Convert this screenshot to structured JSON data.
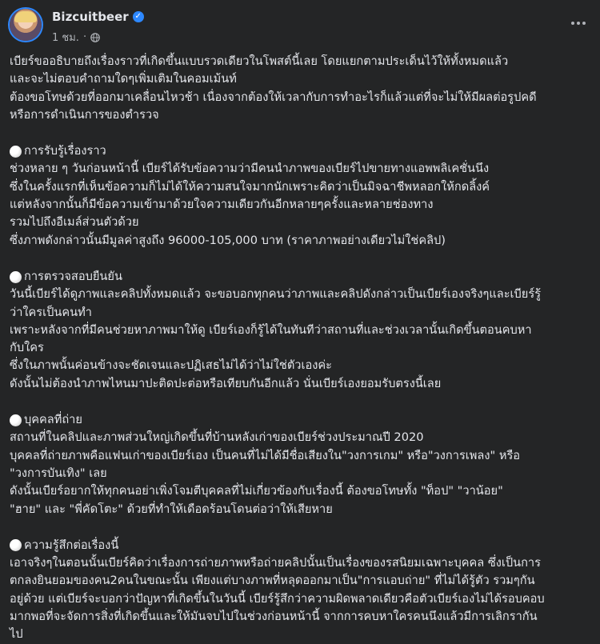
{
  "post": {
    "author": "Bizcuitbeer",
    "time": "1 ชม.",
    "meta_separator": "·"
  },
  "intro": [
    "เบียร์ขออธิบายถึงเรื่องราวที่เกิดขึ้นแบบรวดเดียวในโพสต์นี้เลย โดยแยกตามประเด็นไว้ให้ทั้งหมดแล้ว",
    "และจะไม่ตอบคำถามใดๆเพิ่มเติมในคอมเม้นท์",
    "ต้องขอโทษด้วยที่ออกมาเคลื่อนไหวช้า เนื่องจากต้องให้เวลากับการทำอะไรก็แล้วแต่ที่จะไม่ให้มีผลต่อรูปคดี",
    "หรือการดำเนินการของตำรวจ"
  ],
  "sections": [
    {
      "title": "การรับรู้เรื่องราว",
      "lines": [
        "ช่วงหลาย ๆ วันก่อนหน้านี้ เบียร์ได้รับข้อความว่ามีคนนำภาพของเบียร์ไปขายทางแอพพลิเคชั่นนึง",
        "ซึ่งในครั้งแรกที่เห็นข้อความก็ไม่ได้ให้ความสนใจมากนักเพราะคิดว่าเป็นมิจฉาชีพหลอกให้กดลิ้งค์",
        "แต่หลังจากนั้นก็มีข้อความเข้ามาด้วยใจความเดียวกันอีกหลายๆครั้งและหลายช่องทาง",
        "รวมไปถึงอีเมล์ส่วนตัวด้วย",
        "ซึ่งภาพดังกล่าวนั้นมีมูลค่าสูงถึง 96000-105,000 บาท (ราคาภาพอย่างเดียวไม่ใช่คลิป)"
      ]
    },
    {
      "title": "การตรวจสอบยืนยัน",
      "lines": [
        "วันนี้เบียร์ได้ดูภาพและคลิปทั้งหมดแล้ว จะขอบอกทุกคนว่าภาพและคลิปดังกล่าวเป็นเบียร์เองจริงๆและเบียร์รู้",
        "ว่าใครเป็นคนทำ",
        "เพราะหลังจากที่มีคนช่วยหาภาพมาให้ดู เบียร์เองก็รู้ได้ในทันทีว่าสถานที่และช่วงเวลานั้นเกิดขึ้นตอนคบหา",
        "กับใคร",
        "ซึ่งในภาพนั้นค่อนข้างจะชัดเจนและปฏิเสธไม่ได้ว่าไม่ใช่ตัวเองค่ะ",
        "ดังนั้นไม่ต้องนำภาพไหนมาปะติดปะต่อหรือเทียบกันอีกแล้ว นั่นเบียร์เองยอมรับตรงนี้เลย"
      ]
    },
    {
      "title": "บุคคลที่ถ่าย",
      "lines": [
        "สถานที่ในคลิปและภาพส่วนใหญ่เกิดขึ้นที่บ้านหลังเก่าของเบียร์ช่วงประมาณปี 2020",
        "บุคคลที่ถ่ายภาพคือแฟนเก่าของเบียร์เอง เป็นคนที่ไม่ได้มีชื่อเสียงใน\"วงการเกม\" หรือ\"วงการเพลง\" หรือ",
        "\"วงการบันเทิง\" เลย",
        "ดังนั้นเบียร์อยากให้ทุกคนอย่าเพิ่งโจมตีบุคคลที่ไม่เกี่ยวข้องกับเรื่องนี้  ต้องขอโทษทั้ง \"ท็อป\"  \"วาน้อย\"",
        "\"ฮาย\" และ \"พี่คัดโตะ\" ด้วยที่ทำให้เดือดร้อนโดนต่อว่าให้เสียหาย"
      ]
    },
    {
      "title": "ความรู้สึกต่อเรื่องนี้",
      "lines": [
        "เอาจริงๆในตอนนั้นเบียร์คิดว่าเรื่องการถ่ายภาพหรือถ่ายคลิปนั้นเป็นเรื่องของรสนิยมเฉพาะบุคคล ซึ่งเป็นการ",
        "ตกลงยินยอมของคน2คนในขณะนั้น เพียงแต่บางภาพที่หลุดออกมาเป็น\"การแอบถ่าย\" ที่ไม่ได้รู้ตัว รวมๆกัน",
        "อยู่ด้วย แต่เบียร์จะบอกว่าปัญหาที่เกิดขึ้นในวันนี้ เบียร์รู้สึกว่าความผิดพลาดเดียวคือตัวเบียร์เองไม่ได้รอบคอบ",
        "มากพอที่จะจัดการสิ่งที่เกิดขึ้นและให้มันจบไปในช่วงก่อนหน้านี้ จากการคบหาใครคนนึงแล้วมีการเลิกรากัน",
        "ไป"
      ]
    }
  ],
  "icons": {
    "verified": "verified-badge-icon",
    "globe": "globe-icon",
    "more": "more-options-icon",
    "bullet": "white-circle-icon"
  },
  "colors": {
    "background": "#242526",
    "text": "#e4e6eb",
    "secondary_text": "#b0b3b8",
    "accent": "#2d88ff"
  }
}
